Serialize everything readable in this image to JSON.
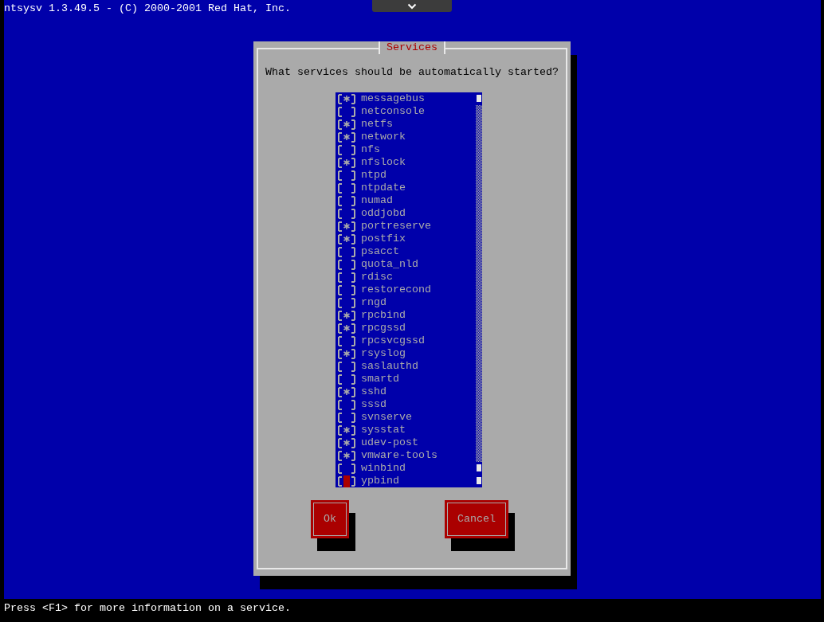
{
  "screen_title": "ntsysv 1.3.49.5 - (C) 2000-2001 Red Hat, Inc.",
  "dialog": {
    "title": "Services",
    "prompt": "What services should be automatically started?"
  },
  "services": [
    {
      "name": "messagebus",
      "checked": true,
      "selected": false
    },
    {
      "name": "netconsole",
      "checked": false,
      "selected": false
    },
    {
      "name": "netfs",
      "checked": true,
      "selected": false
    },
    {
      "name": "network",
      "checked": true,
      "selected": false
    },
    {
      "name": "nfs",
      "checked": false,
      "selected": false
    },
    {
      "name": "nfslock",
      "checked": true,
      "selected": false
    },
    {
      "name": "ntpd",
      "checked": false,
      "selected": false
    },
    {
      "name": "ntpdate",
      "checked": false,
      "selected": false
    },
    {
      "name": "numad",
      "checked": false,
      "selected": false
    },
    {
      "name": "oddjobd",
      "checked": false,
      "selected": false
    },
    {
      "name": "portreserve",
      "checked": true,
      "selected": false
    },
    {
      "name": "postfix",
      "checked": true,
      "selected": false
    },
    {
      "name": "psacct",
      "checked": false,
      "selected": false
    },
    {
      "name": "quota_nld",
      "checked": false,
      "selected": false
    },
    {
      "name": "rdisc",
      "checked": false,
      "selected": false
    },
    {
      "name": "restorecond",
      "checked": false,
      "selected": false
    },
    {
      "name": "rngd",
      "checked": false,
      "selected": false
    },
    {
      "name": "rpcbind",
      "checked": true,
      "selected": false
    },
    {
      "name": "rpcgssd",
      "checked": true,
      "selected": false
    },
    {
      "name": "rpcsvcgssd",
      "checked": false,
      "selected": false
    },
    {
      "name": "rsyslog",
      "checked": true,
      "selected": false
    },
    {
      "name": "saslauthd",
      "checked": false,
      "selected": false
    },
    {
      "name": "smartd",
      "checked": false,
      "selected": false
    },
    {
      "name": "sshd",
      "checked": true,
      "selected": false
    },
    {
      "name": "sssd",
      "checked": false,
      "selected": false
    },
    {
      "name": "svnserve",
      "checked": false,
      "selected": false
    },
    {
      "name": "sysstat",
      "checked": true,
      "selected": false
    },
    {
      "name": "udev-post",
      "checked": true,
      "selected": false
    },
    {
      "name": "vmware-tools",
      "checked": true,
      "selected": false
    },
    {
      "name": "winbind",
      "checked": false,
      "selected": false
    },
    {
      "name": "ypbind",
      "checked": false,
      "selected": true
    }
  ],
  "buttons": [
    {
      "label": "Ok",
      "kind": "ok"
    },
    {
      "label": "Cancel",
      "kind": "cancel"
    }
  ],
  "status_bar": "Press <F1> for more information on a service."
}
